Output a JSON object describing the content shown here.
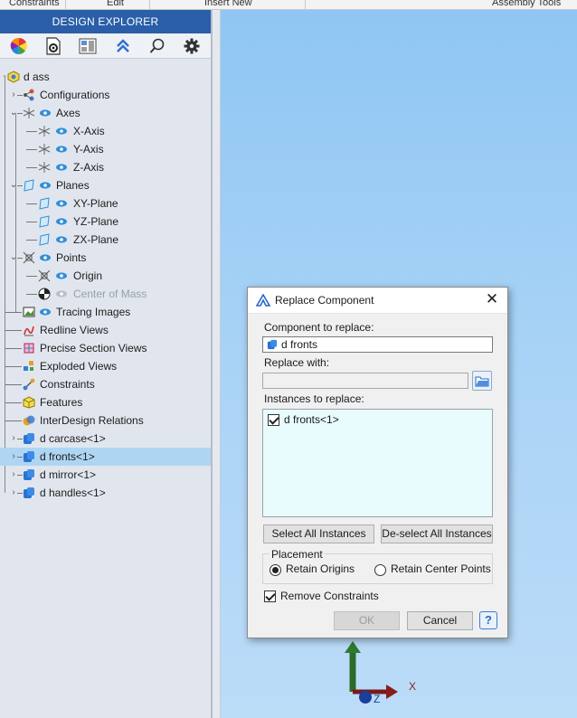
{
  "ribbon": {
    "tabs": [
      "Constraints",
      "Edit",
      "Insert New",
      "Assembly Tools"
    ]
  },
  "explorer": {
    "title": "DESIGN EXPLORER",
    "toolbar_icons": [
      "color-wheel-icon",
      "settings-doc-icon",
      "layout-icon",
      "collapse-up-icon",
      "search-icon",
      "gear-icon"
    ],
    "tree": [
      {
        "label": "d ass",
        "icon": "assembly-icon"
      },
      {
        "label": "Configurations",
        "icon": "configurations-icon"
      },
      {
        "label": "Axes",
        "icon": "axes-icon"
      },
      {
        "label": "X-Axis",
        "icon": "axis-icon"
      },
      {
        "label": "Y-Axis",
        "icon": "axis-icon"
      },
      {
        "label": "Z-Axis",
        "icon": "axis-icon"
      },
      {
        "label": "Planes",
        "icon": "planes-icon"
      },
      {
        "label": "XY-Plane",
        "icon": "plane-icon"
      },
      {
        "label": "YZ-Plane",
        "icon": "plane-icon"
      },
      {
        "label": "ZX-Plane",
        "icon": "plane-icon"
      },
      {
        "label": "Points",
        "icon": "points-icon"
      },
      {
        "label": "Origin",
        "icon": "origin-icon"
      },
      {
        "label": "Center of Mass",
        "icon": "center-of-mass-icon"
      },
      {
        "label": "Tracing Images",
        "icon": "image-icon"
      },
      {
        "label": "Redline Views",
        "icon": "redline-icon"
      },
      {
        "label": "Precise Section Views",
        "icon": "section-icon"
      },
      {
        "label": "Exploded Views",
        "icon": "exploded-icon"
      },
      {
        "label": "Constraints",
        "icon": "constraints-icon"
      },
      {
        "label": "Features",
        "icon": "features-icon"
      },
      {
        "label": "InterDesign Relations",
        "icon": "relations-icon"
      },
      {
        "label": "d carcase<1>",
        "icon": "part-icon"
      },
      {
        "label": "d fronts<1>",
        "icon": "part-icon"
      },
      {
        "label": "d mirror<1>",
        "icon": "part-icon"
      },
      {
        "label": "d handles<1>",
        "icon": "part-icon"
      }
    ]
  },
  "dialog": {
    "title": "Replace Component",
    "component_label": "Component to replace:",
    "component_value": "d fronts",
    "replace_with_label": "Replace with:",
    "replace_with_value": "",
    "instances_label": "Instances to replace:",
    "instances": [
      {
        "label": "d fronts<1>",
        "checked": true
      }
    ],
    "select_all": "Select All Instances",
    "deselect_all": "De-select All Instances",
    "placement_label": "Placement",
    "retain_origins": "Retain Origins",
    "retain_center": "Retain Center Points",
    "remove_constraints": "Remove Constraints",
    "ok": "OK",
    "cancel": "Cancel",
    "help": "?"
  },
  "viewport": {
    "axis_x": "X",
    "axis_z": "Z"
  }
}
